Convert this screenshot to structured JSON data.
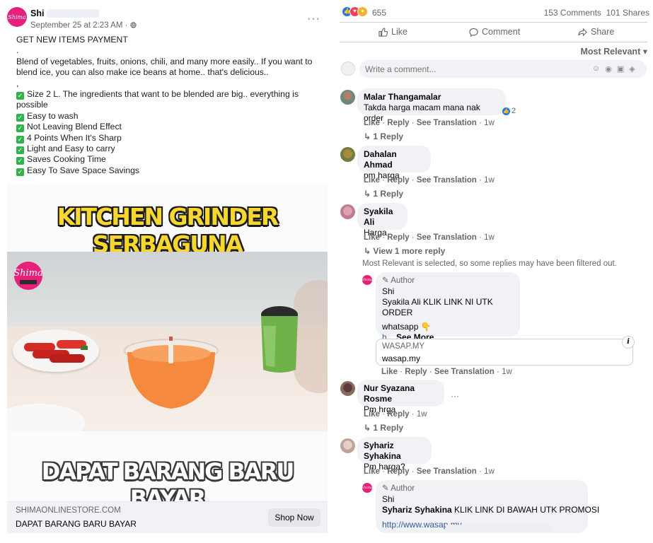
{
  "post": {
    "page_name": "Shi",
    "avatar_text": "Shima",
    "timestamp": "September 25 at 2:23 AM",
    "meta_sep": "·",
    "more_label": "···",
    "heading": "GET NEW ITEMS PAYMENT",
    "blank1": ".",
    "intro": "Blend of vegetables, fruits, onions, chili, and many more easily.. If you want to blend ice, you can also make ice beans at home.. that's delicious..",
    "blank2": ",",
    "features": [
      "Size 2 L. The ingredients that want to be blended are big.. everything is possible",
      "Easy to wash",
      "Not Leaving Blend Effect",
      "4 Points When It's Sharp",
      "Light and Easy to carry",
      "Saves Cooking Time",
      "Easy To Save Space Savings"
    ],
    "media": {
      "headline_top": "KITCHEN GRINDER SERBAGUNA",
      "headline_bottom": "DAPAT BARANG BARU BAYAR",
      "badge_text": "Shima"
    },
    "link": {
      "domain": "SHIMAONLINESTORE.COM",
      "title": "DAPAT BARANG BARU BAYAR",
      "cta": "Shop Now"
    }
  },
  "engagement": {
    "reaction_count": "655",
    "comments": "153 Comments",
    "shares": "101 Shares",
    "like_label": "Like",
    "comment_label": "Comment",
    "share_label": "Share",
    "sort_label": "Most Relevant",
    "write_placeholder": "Write a comment..."
  },
  "comments": [
    {
      "name": "Malar Thangamalar",
      "text": "Takda harga macam mana nak order",
      "like_count": "2",
      "actions": [
        "Like",
        "Reply",
        "See Translation"
      ],
      "time": "1w",
      "replies": "1 Reply"
    },
    {
      "name": "Dahalan Ahmad",
      "text": "pm harga",
      "actions": [
        "Like",
        "Reply",
        "See Translation"
      ],
      "time": "1w",
      "replies": "1 Reply"
    },
    {
      "name": "Syakila Ali",
      "text": "Harga",
      "actions": [
        "Like",
        "Reply",
        "See Translation"
      ],
      "time": "1w",
      "replies": "View 1 more reply",
      "filter_note": "Most Relevant is selected, so some replies may have been filtered out.",
      "author_reply": {
        "author_label": "Author",
        "name": "Shi",
        "line1": "Syakila Ali KLIK LINK NI UTK ORDER",
        "line2": "whatsapp 👇",
        "line3": "h...",
        "see_more": "See More",
        "preview_domain": "WASAP.MY",
        "preview_title": "wasap.my",
        "info": "i",
        "actions": [
          "Like",
          "Reply",
          "See Translation"
        ],
        "time": "1w"
      }
    },
    {
      "name": "Nur Syazana Rosme",
      "text": "Pm hrga",
      "actions": [
        "Like",
        "Reply"
      ],
      "time": "1w",
      "replies": "1 Reply",
      "more": "···"
    },
    {
      "name": "Syhariz Syhakina",
      "text": "Pm harga?",
      "actions": [
        "Like",
        "Reply",
        "See Translation"
      ],
      "time": "1w",
      "author_reply": {
        "author_label": "Author",
        "name": "Shi",
        "tagged": "Syhariz Syhakina",
        "message": " KLIK LINK DI BAWAH UTK PROMOSI",
        "link": "http://www.wasap.my"
      }
    }
  ],
  "colors": {
    "brand_pink": "#e8207a",
    "fb_blue": "#1877f2",
    "headline_yellow": "#f7d72a",
    "bubble_gray": "#f0f2f5"
  }
}
